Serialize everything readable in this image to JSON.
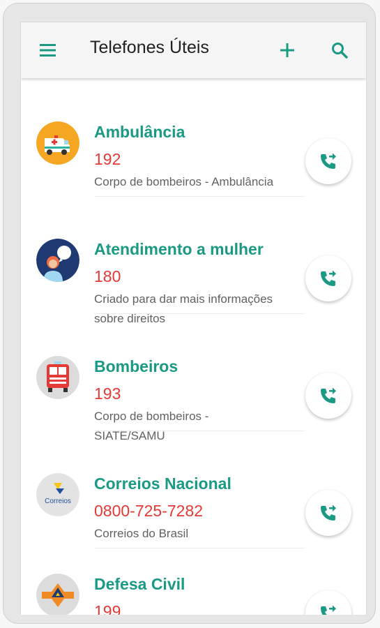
{
  "appbar": {
    "title": "Telefones Úteis",
    "menu_icon": "hamburger-menu-icon",
    "add_icon": "plus-icon",
    "search_icon": "search-icon"
  },
  "colors": {
    "accent": "#1a9a84",
    "phone": "#e53935",
    "text_secondary": "#616161"
  },
  "contacts": [
    {
      "name": "Ambulância",
      "phone": "192",
      "description": "Corpo de bombeiros - Ambulância",
      "icon": "ambulance-icon",
      "call_icon": "phone-forward-icon"
    },
    {
      "name": "Atendimento a mulher",
      "phone": "180",
      "description": "Criado para dar mais informações sobre direitos",
      "icon": "woman-support-icon",
      "call_icon": "phone-forward-icon"
    },
    {
      "name": "Bombeiros",
      "phone": "193",
      "description": "Corpo de bombeiros - SIATE/SAMU",
      "icon": "fire-truck-icon",
      "call_icon": "phone-forward-icon"
    },
    {
      "name": "Correios Nacional",
      "phone": "0800-725-7282",
      "description": "Correios do Brasil",
      "icon": "correios-logo-icon",
      "logo_text": "Correios",
      "call_icon": "phone-forward-icon"
    },
    {
      "name": "Defesa Civil",
      "phone": "199",
      "description": "",
      "icon": "civil-defense-icon",
      "call_icon": "phone-forward-icon"
    }
  ]
}
